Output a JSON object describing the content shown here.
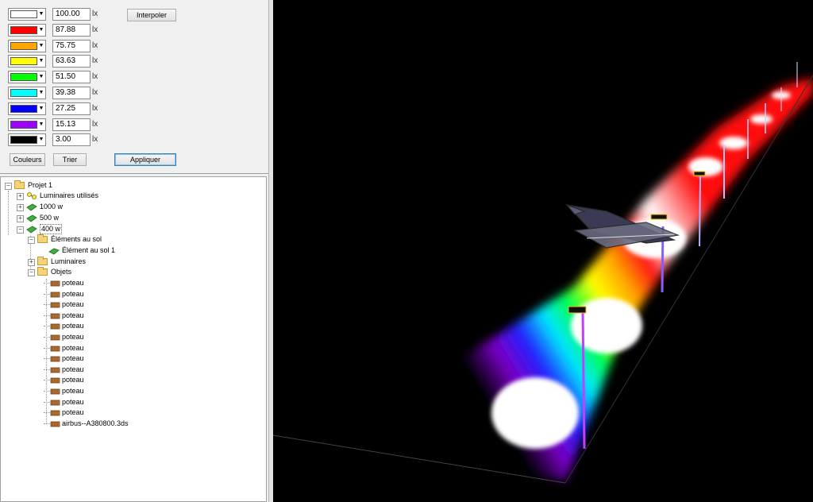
{
  "color_scale": {
    "unit": "lx",
    "rows": [
      {
        "color": "#ffffff",
        "value": "100.00"
      },
      {
        "color": "#ff0000",
        "value": "87.88"
      },
      {
        "color": "#ffa500",
        "value": "75.75"
      },
      {
        "color": "#ffff00",
        "value": "63.63"
      },
      {
        "color": "#00ff00",
        "value": "51.50"
      },
      {
        "color": "#00ffff",
        "value": "39.38"
      },
      {
        "color": "#0000ff",
        "value": "27.25"
      },
      {
        "color": "#a000ff",
        "value": "15.13"
      },
      {
        "color": "#000000",
        "value": "3.00"
      }
    ],
    "interpolate_label": "Interpoler",
    "colors_label": "Couleurs",
    "sort_label": "Trier",
    "apply_label": "Appliquer"
  },
  "tree": {
    "root": "Projet 1",
    "luminaires_used": "Luminaires utilisés",
    "groups": [
      "1000 w",
      "500 w",
      "400 w"
    ],
    "ground_elements": "Éléments au sol",
    "ground_element_1": "Élément au sol 1",
    "luminaires": "Luminaires",
    "objects": "Objets",
    "object_items": [
      "poteau",
      "poteau",
      "poteau",
      "poteau",
      "poteau",
      "poteau",
      "poteau",
      "poteau",
      "poteau",
      "poteau",
      "poteau",
      "poteau",
      "poteau",
      "airbus--A380800.3ds"
    ]
  }
}
